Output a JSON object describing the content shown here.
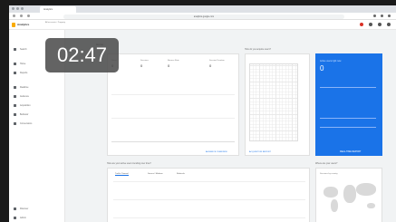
{
  "browser": {
    "tab_title": "Analytics",
    "url": "analytics.google.com"
  },
  "app": {
    "title": "Analytics",
    "property_label": "All accounts › Property"
  },
  "sidebar": {
    "items": [
      {
        "icon": "search-icon",
        "label": "Search"
      },
      {
        "icon": "home-icon",
        "label": "Home"
      },
      {
        "icon": "reports-icon",
        "label": "Reports"
      },
      {
        "icon": "clock-icon",
        "label": "Realtime"
      },
      {
        "icon": "user-icon",
        "label": "Audience"
      },
      {
        "icon": "acquisition-icon",
        "label": "Acquisition"
      },
      {
        "icon": "behavior-icon",
        "label": "Behavior"
      },
      {
        "icon": "flag-icon",
        "label": "Conversions"
      }
    ],
    "bottom_items": [
      {
        "icon": "lightbulb-icon",
        "label": "Discover"
      },
      {
        "icon": "gear-icon",
        "label": "Admin"
      }
    ]
  },
  "timer": "02:47",
  "overview": {
    "title": "Home",
    "metrics": [
      {
        "label": "Users",
        "value": "0"
      },
      {
        "label": "Sessions",
        "value": "0"
      },
      {
        "label": "Bounce Rate",
        "value": "0"
      },
      {
        "label": "Session Duration",
        "value": "0"
      }
    ],
    "footer_link": "AUDIENCE OVERVIEW"
  },
  "acquisition": {
    "title": "How do you acquire users?",
    "footer_link": "ACQUISITION REPORT"
  },
  "realtime": {
    "title": "Active users right now",
    "value": "0",
    "footer_link": "REAL-TIME REPORT"
  },
  "bottom": {
    "left_title": "How are your active users trending over time?",
    "tabs": [
      "Traffic Channel",
      "Source / Medium",
      "Referrals"
    ],
    "right_title": "Where are your users?",
    "right_sub": "Sessions by country"
  }
}
